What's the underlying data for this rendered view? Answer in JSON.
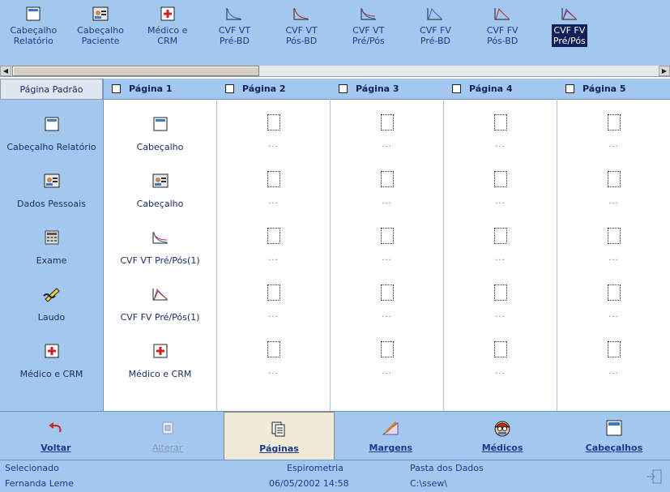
{
  "palette": {
    "items": [
      {
        "label": "Cabeçalho\nRelatório",
        "icon": "report-header-icon"
      },
      {
        "label": "Cabeçalho\nPaciente",
        "icon": "patient-header-icon"
      },
      {
        "label": "Médico e\nCRM",
        "icon": "medical-cross-icon"
      },
      {
        "label": "CVF VT\nPré-BD",
        "icon": "curve-vt-icon"
      },
      {
        "label": "CVF VT\nPós-BD",
        "icon": "curve-vt-icon"
      },
      {
        "label": "CVF VT\nPré/Pós",
        "icon": "curve-vt-icon"
      },
      {
        "label": "CVF FV\nPré-BD",
        "icon": "curve-fv-icon"
      },
      {
        "label": "CVF FV\nPós-BD",
        "icon": "curve-fv-icon"
      },
      {
        "label": "CVF FV\nPré/Pós",
        "icon": "curve-fv-icon",
        "selected": true
      }
    ]
  },
  "grid": {
    "left": {
      "header": "Página Padrão",
      "items": [
        "Cabeçalho Relatório",
        "Dados Pessoais",
        "Exame",
        "Laudo",
        "Médico e CRM"
      ]
    },
    "pages": [
      {
        "title": "Página 1",
        "cells": [
          "Cabeçalho",
          "Cabeçalho",
          "CVF VT Pré/Pós(1)",
          "CVF FV Pré/Pós(1)",
          "Médico e CRM"
        ]
      },
      {
        "title": "Página 2"
      },
      {
        "title": "Página 3"
      },
      {
        "title": "Página 4"
      },
      {
        "title": "Página 5"
      }
    ],
    "empty_marker": "..."
  },
  "toolbar": {
    "buttons": [
      {
        "label": "Voltar",
        "mnemonic": "V"
      },
      {
        "label": "Alterar",
        "mnemonic": "A",
        "disabled": true
      },
      {
        "label": "Páginas",
        "mnemonic": "P",
        "active": true
      },
      {
        "label": "Margens",
        "mnemonic": "M"
      },
      {
        "label": "Médicos",
        "mnemonic": "d"
      },
      {
        "label": "Cabeçalhos",
        "mnemonic": "C"
      }
    ]
  },
  "status": {
    "selected_label": "Selecionado",
    "selected_value": "Fernanda Leme",
    "exam_type": "Espirometria",
    "datetime": "06/05/2002 14:58",
    "data_folder_label": "Pasta dos Dados",
    "data_folder_path": "C:\\ssew\\"
  },
  "colors": {
    "panel": "#a3c8f0",
    "text": "#1a3a8c",
    "selected": "#11205a",
    "active_button": "#efebd8"
  }
}
